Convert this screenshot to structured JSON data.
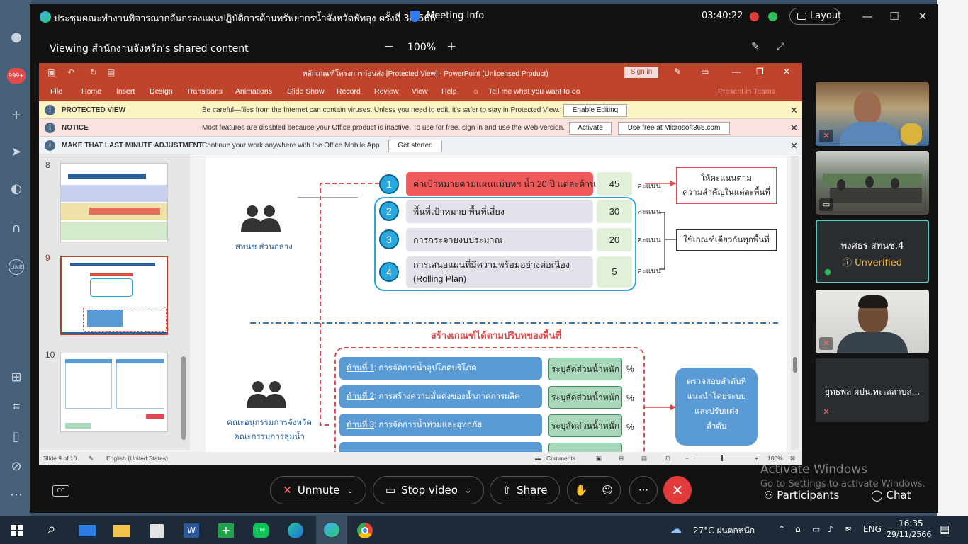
{
  "window": {
    "title": "ประชุมคณะทำงานพิจารณากลั่นกรองแผนปฏิบัติการด้านทรัพยากรน้ำจังหวัดพัทลุง ครั้งที่ 3/2566",
    "meeting_info": "Meeting Info",
    "clock": "03:40:22",
    "layout_label": "Layout"
  },
  "sharebar": {
    "viewing": "Viewing สำนักงานจังหวัด's shared content",
    "zoom_out": "−",
    "zoom": "100%",
    "zoom_in": "+"
  },
  "ppt": {
    "title": "หลักเกณฑ์โครงการก่อนส่ง [Protected View] - PowerPoint (Unlicensed Product)",
    "sign_in": "Sign in",
    "menu": [
      "File",
      "Home",
      "Insert",
      "Design",
      "Transitions",
      "Animations",
      "Slide Show",
      "Record",
      "Review",
      "View",
      "Help"
    ],
    "tell_me": "Tell me what you want to do",
    "present_teams": "Present in Teams",
    "protected": {
      "heading": "PROTECTED VIEW",
      "message": "Be careful—files from the Internet can contain viruses. Unless you need to edit, it's safer to stay in Protected View.",
      "button": "Enable Editing"
    },
    "notice": {
      "heading": "NOTICE",
      "message": "Most features are disabled because your Office product is inactive. To use for free, sign in and use the Web version.",
      "button1": "Activate",
      "button2": "Use free at Microsoft365.com"
    },
    "adjust": {
      "heading": "MAKE THAT LAST MINUTE ADJUSTMENT",
      "message": "Continue your work anywhere with the Office Mobile App",
      "button": "Get started"
    },
    "thumb_numbers": [
      "8",
      "9",
      "10"
    ],
    "status": {
      "slide": "Slide 9 of 10",
      "language": "English (United States)",
      "comments": "Comments",
      "zoom": "100%"
    }
  },
  "slide": {
    "group1_label": "สทนช.ส่วนกลาง",
    "group2_label_1": "คณะอนุกรรมการจังหวัด",
    "group2_label_2": "คณะกรรมการลุ่มน้ำ",
    "criteria": [
      {
        "num": "1",
        "text": "ค่าเป้าหมายตามแผนแม่บทฯ น้ำ 20 ปี แต่ละด้าน",
        "score": "45"
      },
      {
        "num": "2",
        "text": "พื้นที่เป้าหมาย พื้นที่เสี่ยง",
        "score": "30"
      },
      {
        "num": "3",
        "text": "การกระจายงบประมาณ",
        "score": "20"
      },
      {
        "num": "4",
        "text": "การเสนอแผนที่มีความพร้อมอย่างต่อเนื่อง",
        "text2": "(Rolling Plan)",
        "score": "5"
      }
    ],
    "unit": "คะแนน",
    "note1_line1": "ให้คะแนนตาม",
    "note1_line2": "ความสำคัญในแต่ละพื้นที่",
    "note2": "ใช้เกณฑ์เดียวกันทุกพื้นที่",
    "section_title": "สร้างเกณฑ์ได้ตามปริบทของพื้นที่",
    "sides": [
      {
        "label": "ด้านที่ 1",
        "text": " : การจัดการน้ำอุปโภคบริโภค"
      },
      {
        "label": "ด้านที่ 2",
        "text": " : การสร้างความมั่นคงของน้ำภาคการผลิต"
      },
      {
        "label": "ด้านที่ 3",
        "text": " : การจัดการน้ำท่วมและอุทกภัย"
      }
    ],
    "weight_label": "ระบุสัดส่วนน้ำหนัก",
    "percent": "%",
    "verify_line1": "ตรวจสอบลำดับที่",
    "verify_line2": "แนะนำโดยระบบ",
    "verify_line3": "และปรับแต่ง",
    "verify_line4": "ลำดับ"
  },
  "participants": {
    "tile3_name": "พงศธร สทนช.4",
    "tile3_status": "Unverified",
    "tile5_name": "ยุทธพล ผปน.ทะเลสาบส..."
  },
  "controls": {
    "cc": "CC",
    "unmute": "Unmute",
    "stop_video": "Stop video",
    "share": "Share",
    "more": "···",
    "participants": "Participants",
    "chat": "Chat"
  },
  "watermark": {
    "line1": "Activate Windows",
    "line2": "Go to Settings to activate Windows."
  },
  "taskbar": {
    "weather": "27°C ฝนตกหนัก",
    "lang": "ENG",
    "time": "16:35",
    "date": "29/11/2566"
  },
  "side_badge": "999+",
  "colors": {
    "ppt_red": "#c0442c",
    "webex_bg": "#121212",
    "end_red": "#e23b3b",
    "verified_border": "#5ec9c0",
    "warning_yellow": "#f5b335"
  }
}
